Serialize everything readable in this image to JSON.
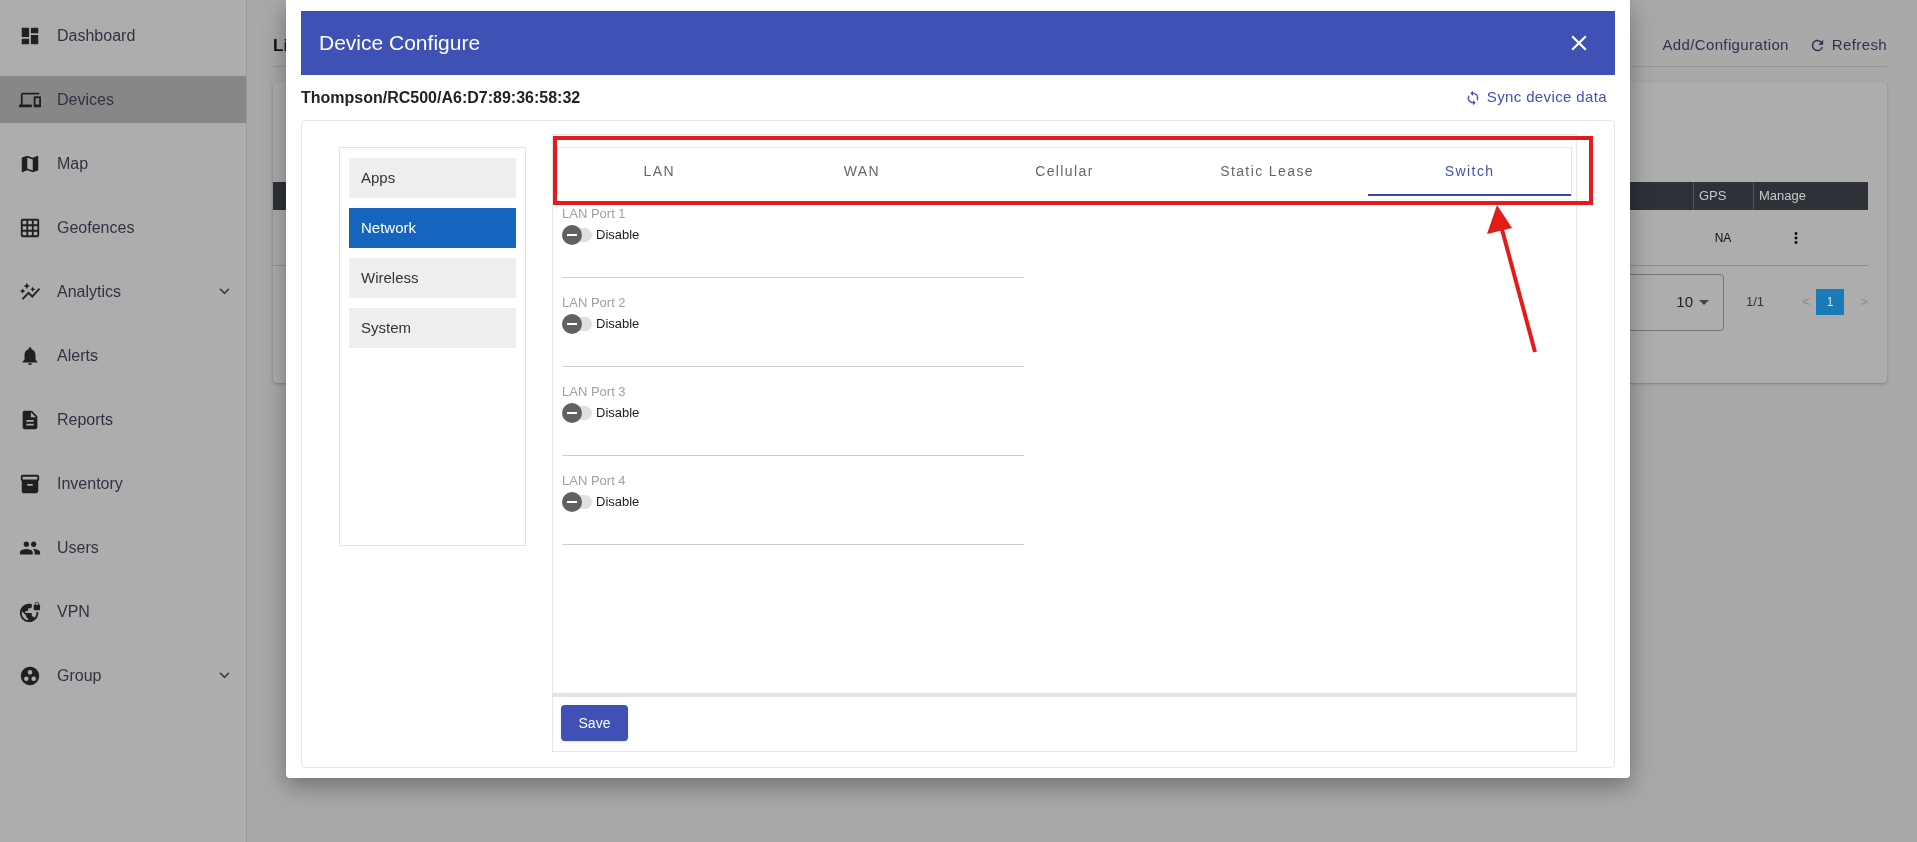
{
  "sidebar": {
    "items": [
      {
        "label": "Dashboard",
        "selected": false,
        "expandable": false
      },
      {
        "label": "Devices",
        "selected": true,
        "expandable": false
      },
      {
        "label": "Map",
        "selected": false,
        "expandable": false
      },
      {
        "label": "Geofences",
        "selected": false,
        "expandable": false
      },
      {
        "label": "Analytics",
        "selected": false,
        "expandable": true
      },
      {
        "label": "Alerts",
        "selected": false,
        "expandable": false
      },
      {
        "label": "Reports",
        "selected": false,
        "expandable": false
      },
      {
        "label": "Inventory",
        "selected": false,
        "expandable": false
      },
      {
        "label": "Users",
        "selected": false,
        "expandable": false
      },
      {
        "label": "VPN",
        "selected": false,
        "expandable": false
      },
      {
        "label": "Group",
        "selected": false,
        "expandable": true
      }
    ]
  },
  "page": {
    "title_fragment": "Li",
    "actions": [
      {
        "label": "Add/Configuration"
      },
      {
        "label": "Refresh"
      }
    ],
    "table": {
      "columns": [
        "GPS",
        "Manage"
      ],
      "rows": [
        {
          "gps": "NA"
        }
      ]
    },
    "pagination": {
      "page_size": "10",
      "page_info": "1/1",
      "prev": "<",
      "pages": [
        {
          "label": "1",
          "selected": true
        }
      ],
      "next": ">"
    }
  },
  "dialog": {
    "title": "Device Configure",
    "device": "Thompson/RC500/A6:D7:89:36:58:32",
    "sync_link": "Sync device data",
    "nav": [
      {
        "label": "Apps",
        "selected": false
      },
      {
        "label": "Network",
        "selected": true
      },
      {
        "label": "Wireless",
        "selected": false
      },
      {
        "label": "System",
        "selected": false
      }
    ],
    "tabs": [
      {
        "label": "LAN",
        "selected": false
      },
      {
        "label": "WAN",
        "selected": false
      },
      {
        "label": "Cellular",
        "selected": false
      },
      {
        "label": "Static Lease",
        "selected": false
      },
      {
        "label": "Switch",
        "selected": true
      }
    ],
    "ports": [
      {
        "label": "LAN Port 1",
        "on": false,
        "state_text": "Disable"
      },
      {
        "label": "LAN Port 2",
        "on": false,
        "state_text": "Disable"
      },
      {
        "label": "LAN Port 3",
        "on": false,
        "state_text": "Disable"
      },
      {
        "label": "LAN Port 4",
        "on": false,
        "state_text": "Disable"
      }
    ],
    "save": "Save"
  }
}
